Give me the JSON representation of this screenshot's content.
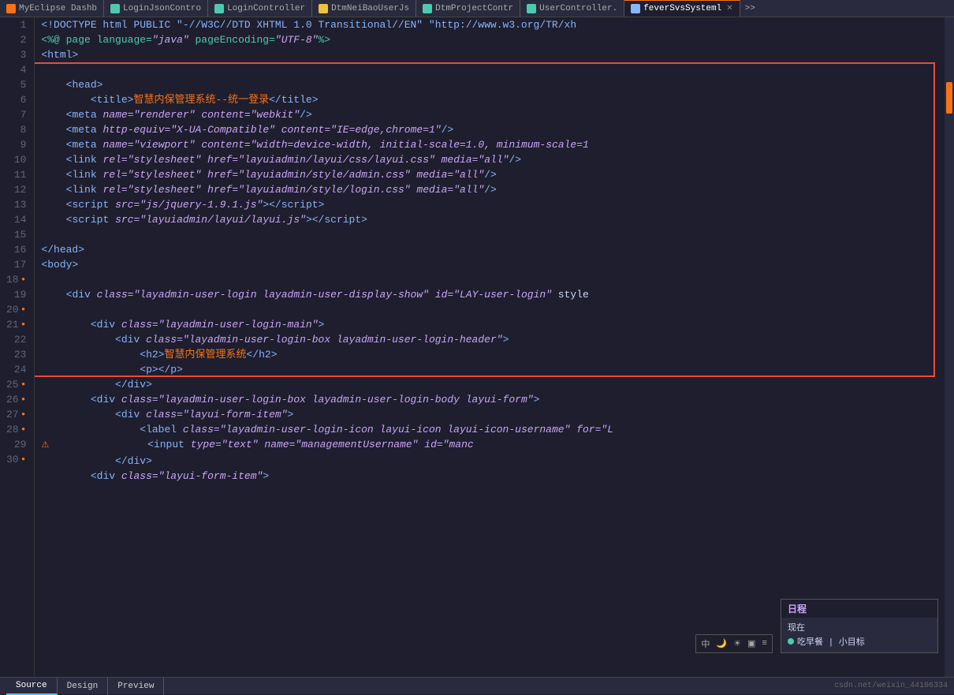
{
  "tabs": [
    {
      "id": "tab1",
      "label": "MyEclipse Dashb",
      "icon_color": "#f97316",
      "active": false,
      "closable": false
    },
    {
      "id": "tab2",
      "label": "LoginJsonContro",
      "icon_color": "#4ec9b0",
      "active": false,
      "closable": false
    },
    {
      "id": "tab3",
      "label": "LoginController",
      "icon_color": "#4ec9b0",
      "active": false,
      "closable": false
    },
    {
      "id": "tab4",
      "label": "DtmNeiBaoUserJs",
      "icon_color": "#f0c040",
      "active": false,
      "closable": false
    },
    {
      "id": "tab5",
      "label": "DtmProjectContr",
      "icon_color": "#4ec9b0",
      "active": false,
      "closable": false
    },
    {
      "id": "tab6",
      "label": "UserController.",
      "icon_color": "#4ec9b0",
      "active": false,
      "closable": false
    },
    {
      "id": "tab7",
      "label": "feverSvsSysteml",
      "icon_color": "#89b4fa",
      "active": true,
      "closable": true
    }
  ],
  "tab_overflow_label": ">>",
  "lines": [
    {
      "num": 1,
      "dot": false,
      "warn": false
    },
    {
      "num": 2,
      "dot": false,
      "warn": false
    },
    {
      "num": 3,
      "dot": false,
      "warn": false
    },
    {
      "num": 4,
      "dot": false,
      "warn": false
    },
    {
      "num": 5,
      "dot": false,
      "warn": false
    },
    {
      "num": 6,
      "dot": false,
      "warn": false
    },
    {
      "num": 7,
      "dot": false,
      "warn": false
    },
    {
      "num": 8,
      "dot": false,
      "warn": false
    },
    {
      "num": 9,
      "dot": false,
      "warn": false
    },
    {
      "num": 10,
      "dot": false,
      "warn": false
    },
    {
      "num": 11,
      "dot": false,
      "warn": false
    },
    {
      "num": 12,
      "dot": false,
      "warn": false
    },
    {
      "num": 13,
      "dot": false,
      "warn": false
    },
    {
      "num": 14,
      "dot": false,
      "warn": false
    },
    {
      "num": 15,
      "dot": false,
      "warn": false
    },
    {
      "num": 16,
      "dot": false,
      "warn": false
    },
    {
      "num": 17,
      "dot": false,
      "warn": false
    },
    {
      "num": 18,
      "dot": true,
      "warn": false
    },
    {
      "num": 19,
      "dot": false,
      "warn": false
    },
    {
      "num": 20,
      "dot": true,
      "warn": false
    },
    {
      "num": 21,
      "dot": true,
      "warn": false
    },
    {
      "num": 22,
      "dot": false,
      "warn": false
    },
    {
      "num": 23,
      "dot": false,
      "warn": false
    },
    {
      "num": 24,
      "dot": false,
      "warn": false
    },
    {
      "num": 25,
      "dot": true,
      "warn": false
    },
    {
      "num": 26,
      "dot": true,
      "warn": false
    },
    {
      "num": 27,
      "dot": true,
      "warn": false
    },
    {
      "num": 28,
      "dot": true,
      "warn": true
    },
    {
      "num": 29,
      "dot": false,
      "warn": false
    },
    {
      "num": 30,
      "dot": true,
      "warn": false
    }
  ],
  "float_panel": {
    "title": "日程",
    "row1": "现在",
    "row2_icon": "dot",
    "row2_text": "吃早餐 | 小目标"
  },
  "status_bar": {
    "source_label": "Source",
    "design_label": "Design",
    "preview_label": "Preview",
    "info_text": "csdn.net/weixin_44106334"
  },
  "toolbar_icons": [
    "中",
    "♦",
    "♦♦",
    "▣",
    "≡"
  ],
  "highlight_region": {
    "top_line": 4,
    "bottom_line": 24
  }
}
